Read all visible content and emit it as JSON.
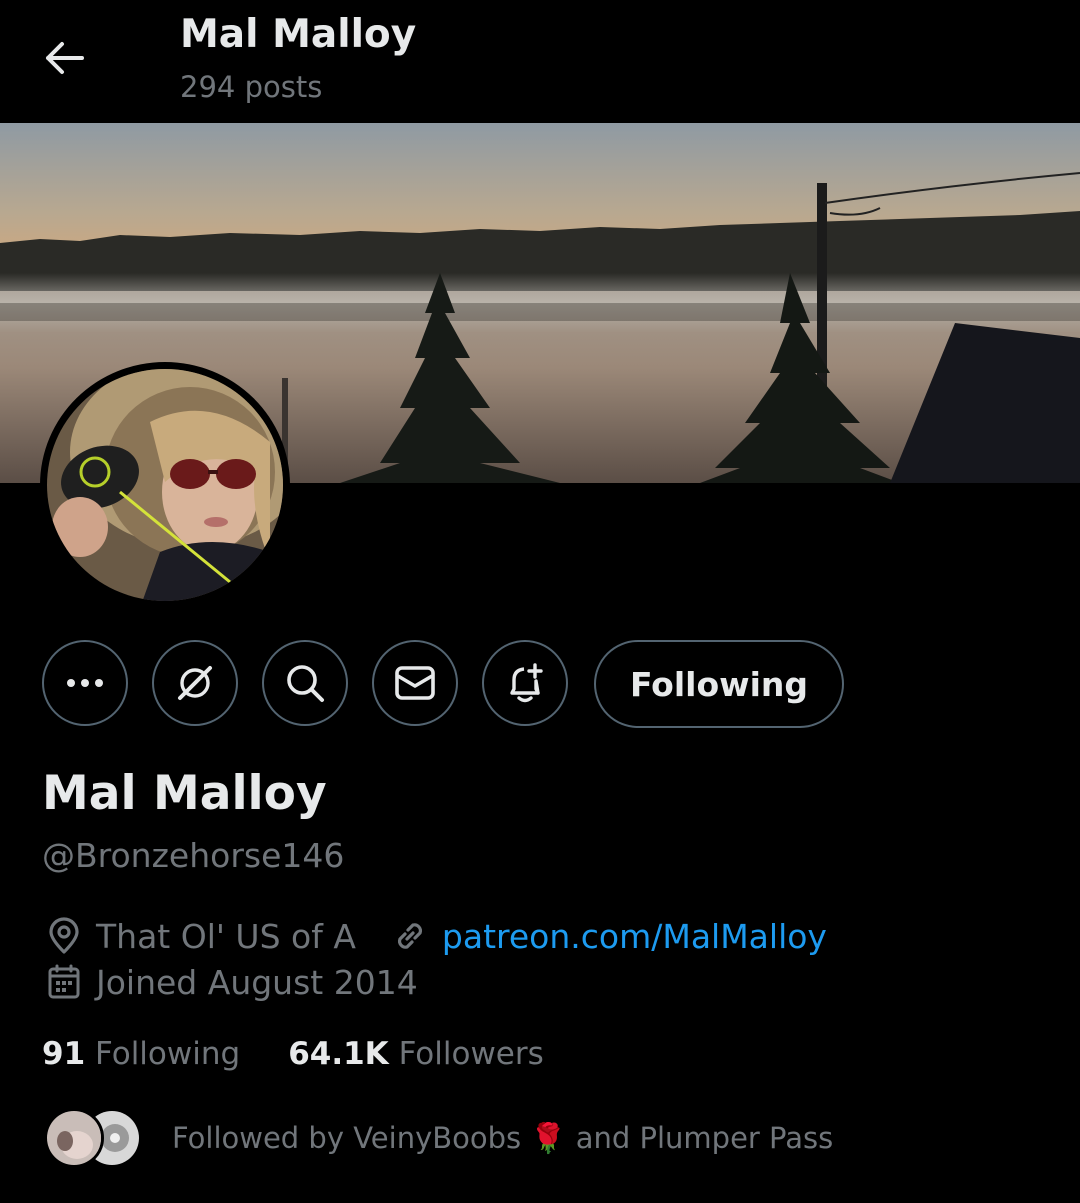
{
  "header": {
    "name": "Mal Malloy",
    "posts": "294 posts"
  },
  "profile": {
    "display_name": "Mal Malloy",
    "handle": "@Bronzehorse146",
    "location": "That Ol' US of A",
    "website": "patreon.com/MalMalloy",
    "joined": "Joined August 2014"
  },
  "actions": {
    "follow_label": "Following",
    "icons": [
      "more-icon",
      "grok-icon",
      "search-icon",
      "message-icon",
      "notification-add-icon"
    ]
  },
  "stats": {
    "following_count": "91",
    "following_label": "Following",
    "followers_count": "64.1K",
    "followers_label": "Followers"
  },
  "followed_by": {
    "prefix": "Followed by VeinyBoobs",
    "emoji": "🌹",
    "suffix": "and Plumper Pass"
  },
  "colors": {
    "background": "#000000",
    "text_primary": "#e7e9ea",
    "text_secondary": "#71767b",
    "link": "#1d9bf0",
    "border": "#536471"
  }
}
